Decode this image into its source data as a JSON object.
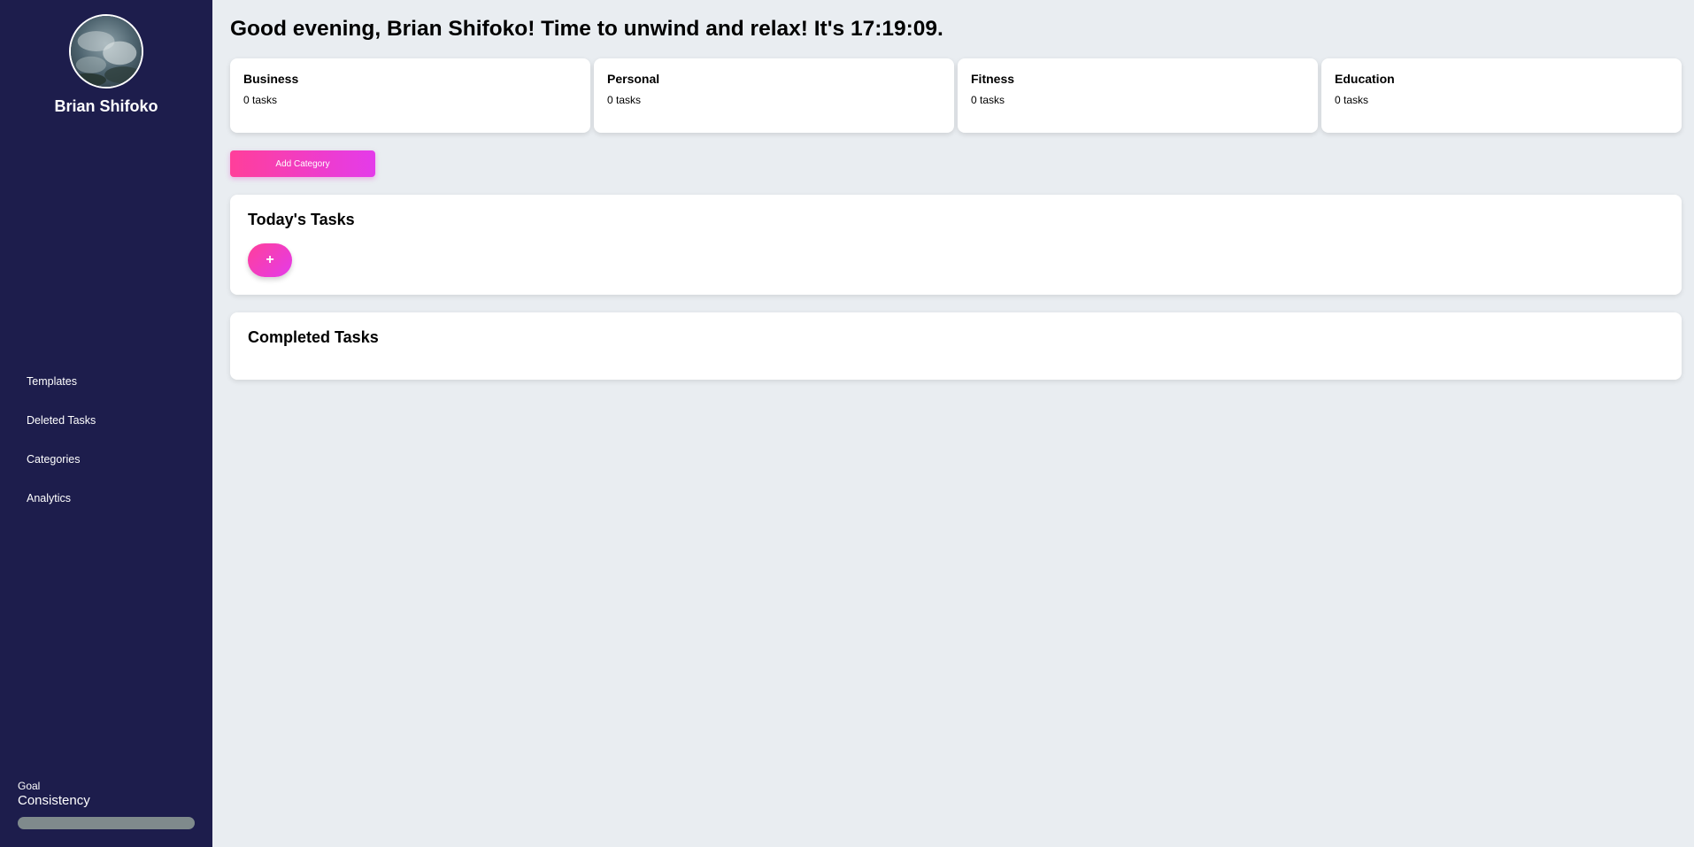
{
  "user": {
    "name": "Brian Shifoko",
    "avatar_icon": "cloudy-sky-avatar"
  },
  "greeting": "Good evening, Brian Shifoko! Time to unwind and relax! It's 17:19:09.",
  "sidebar": {
    "items": [
      {
        "label": "Templates"
      },
      {
        "label": "Deleted Tasks"
      },
      {
        "label": "Categories"
      },
      {
        "label": "Analytics"
      }
    ],
    "goal": {
      "label": "Goal",
      "title": "Consistency"
    }
  },
  "categories": [
    {
      "name": "Business",
      "count": "0 tasks"
    },
    {
      "name": "Personal",
      "count": "0 tasks"
    },
    {
      "name": "Fitness",
      "count": "0 tasks"
    },
    {
      "name": "Education",
      "count": "0 tasks"
    }
  ],
  "add_category_label": "Add Category",
  "today": {
    "title": "Today's Tasks",
    "add_button_label": "+"
  },
  "completed": {
    "title": "Completed Tasks"
  },
  "colors": {
    "sidebar_bg": "#1d1d4c",
    "page_bg": "#e9edf1",
    "accent_start": "#ff3f9a",
    "accent_end": "#e43bea",
    "goal_bar": "#7f8a8c"
  }
}
